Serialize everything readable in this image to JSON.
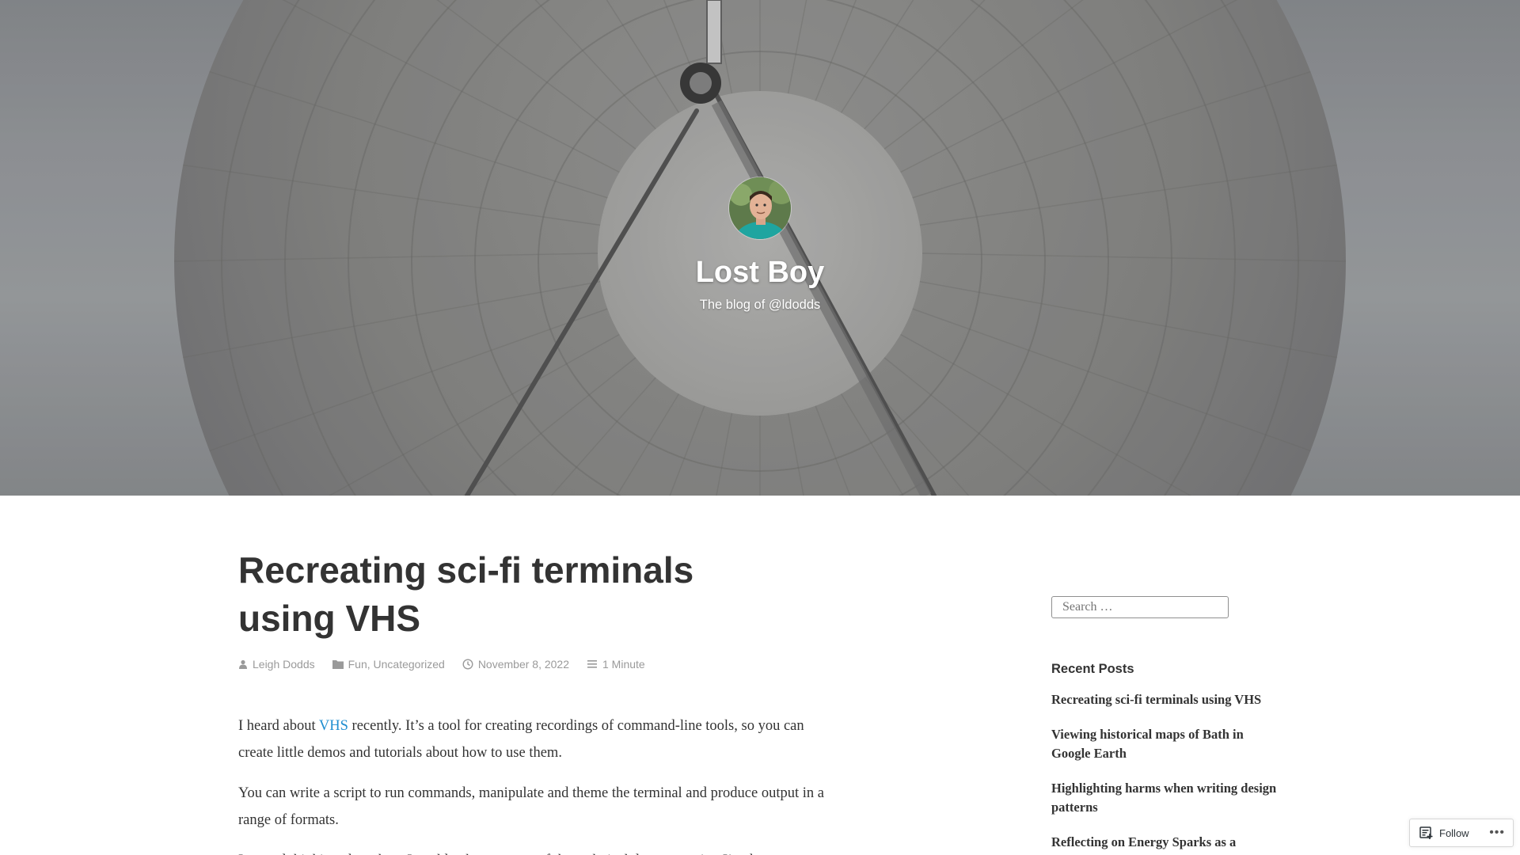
{
  "site": {
    "title": "Lost Boy",
    "tagline": "The blog of @ldodds"
  },
  "article": {
    "title": "Recreating sci-fi terminals using VHS",
    "meta": {
      "author": "Leigh Dodds",
      "categories": [
        "Fun",
        "Uncategorized"
      ],
      "category_separator": ", ",
      "date": "November 8, 2022",
      "reading_time": "1 Minute"
    },
    "paragraphs": [
      {
        "before_link": "I heard about ",
        "link_text": "VHS",
        "after_link": " recently. It’s a tool for creating recordings of command-line tools, so you can create little demos and tutorials about how to use them."
      },
      {
        "text": "You can write a script to run commands, manipulate and theme the terminal and produce output in a range of formats."
      },
      {
        "text": "I started thinking about how I could enhance some of the technical documentation I’ve been"
      }
    ]
  },
  "sidebar": {
    "search_placeholder": "Search …",
    "recent_posts_title": "Recent Posts",
    "recent_posts": [
      "Recreating sci-fi terminals using VHS",
      "Viewing historical maps of Bath in Google Earth",
      "Highlighting harms when writing design patterns",
      "Reflecting on Energy Sparks as a “Community Tech” project"
    ]
  },
  "follow_bar": {
    "follow_label": "Follow",
    "more_label": "•••"
  },
  "icons": {
    "author": "person-icon",
    "categories": "folder-icon",
    "date": "clock-icon",
    "reading_time": "list-icon",
    "follow": "reader-follow-icon"
  },
  "colors": {
    "link": "#1f8ed0",
    "text": "#333333",
    "meta": "#9a9a9a",
    "hero_title": "#ffffff"
  }
}
